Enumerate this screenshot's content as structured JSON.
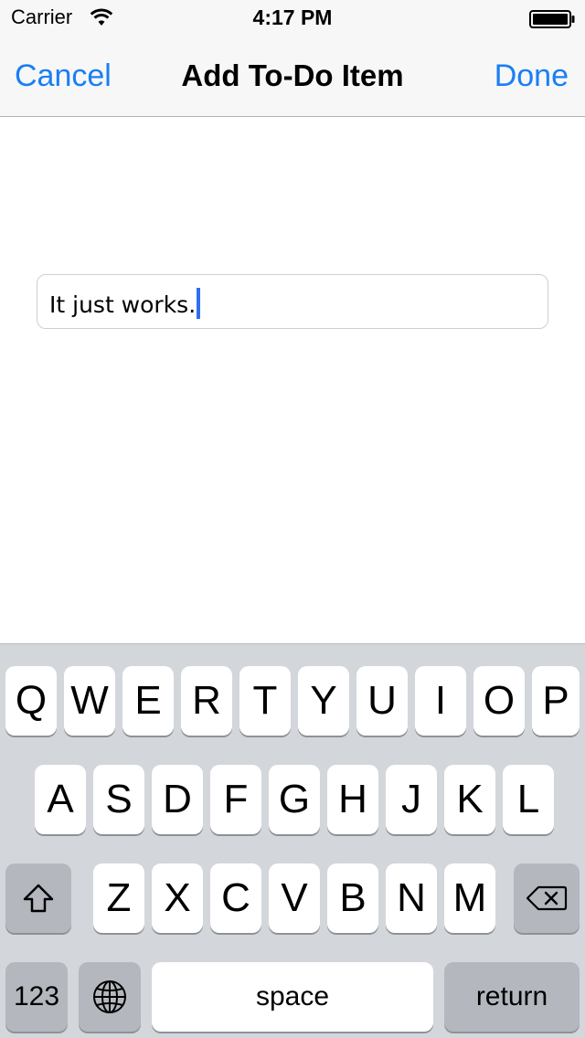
{
  "status_bar": {
    "carrier": "Carrier",
    "time": "4:17 PM",
    "icons": [
      "wifi-icon",
      "battery-icon"
    ]
  },
  "nav_bar": {
    "cancel_label": "Cancel",
    "title": "Add To-Do Item",
    "done_label": "Done",
    "tint_color": "#1a7ef5"
  },
  "text_field": {
    "value": "It just works."
  },
  "keyboard": {
    "row1": [
      "Q",
      "W",
      "E",
      "R",
      "T",
      "Y",
      "U",
      "I",
      "O",
      "P"
    ],
    "row2": [
      "A",
      "S",
      "D",
      "F",
      "G",
      "H",
      "J",
      "K",
      "L"
    ],
    "row3": [
      "Z",
      "X",
      "C",
      "V",
      "B",
      "N",
      "M"
    ],
    "numbers_label": "123",
    "space_label": "space",
    "return_label": "return",
    "special_icons": [
      "shift-icon",
      "delete-icon",
      "globe-icon"
    ]
  }
}
